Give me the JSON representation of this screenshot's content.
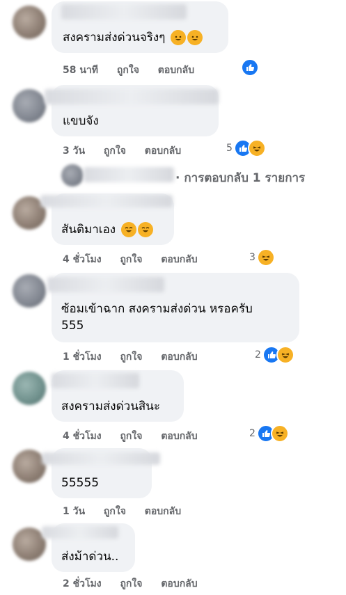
{
  "comments": [
    {
      "text": "สงครามส่งด่วนจริงๆ",
      "emoji": [
        "rofl",
        "rofl"
      ],
      "time": "58 นาที",
      "like": "ถูกใจ",
      "reply": "ตอบกลับ",
      "reaction_count": "",
      "reactions": [
        "like"
      ]
    },
    {
      "text": "แขบจัง",
      "time": "3 วัน",
      "like": "ถูกใจ",
      "reply": "ตอบกลับ",
      "reaction_count": "5",
      "reactions": [
        "like",
        "haha"
      ]
    },
    {
      "text": "สันติมาเอง",
      "emoji": [
        "joy",
        "joy"
      ],
      "time": "4 ชั่วโมง",
      "like": "ถูกใจ",
      "reply": "ตอบกลับ",
      "reaction_count": "3",
      "reactions": [
        "haha"
      ]
    },
    {
      "text_line1": "ซ้อมเข้าฉาก สงครามส่งด่วน หรอครับ",
      "text_line2": "555",
      "time": "1 ชั่วโมง",
      "like": "ถูกใจ",
      "reply": "ตอบกลับ",
      "reaction_count": "2",
      "reactions": [
        "like",
        "haha"
      ]
    },
    {
      "text": "สงครามส่งด่วนสินะ",
      "time": "4 ชั่วโมง",
      "like": "ถูกใจ",
      "reply": "ตอบกลับ",
      "reaction_count": "2",
      "reactions": [
        "like",
        "haha"
      ]
    },
    {
      "text": "55555",
      "time": "1 วัน",
      "like": "ถูกใจ",
      "reply": "ตอบกลับ",
      "reaction_count": "",
      "reactions": []
    },
    {
      "text": "ส่งม้าด่วน..",
      "time": "2 ชั่วโมง",
      "like": "ถูกใจ",
      "reply": "ตอบกลับ",
      "reaction_count": "",
      "reactions": []
    }
  ],
  "reply_summary": "· การตอบกลับ 1 รายการ",
  "partial_name": "Phanusos Ning Ni",
  "colors": {
    "like": "#1877f2",
    "haha": "#f7b125",
    "bubble": "#f0f2f5",
    "meta": "#65676b"
  }
}
